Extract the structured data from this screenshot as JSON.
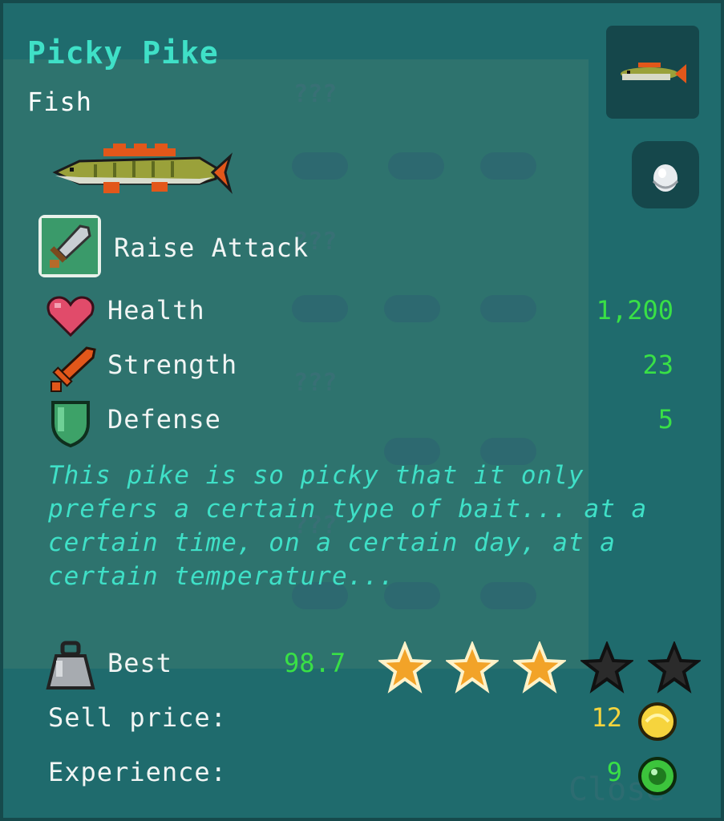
{
  "fish": {
    "name": "Picky Pike",
    "category": "Fish"
  },
  "ability": {
    "label": "Raise Attack",
    "icon": "sword-icon"
  },
  "stats": [
    {
      "label": "Health",
      "value": "1,200",
      "icon": "heart-icon"
    },
    {
      "label": "Strength",
      "value": "23",
      "icon": "sword-icon"
    },
    {
      "label": "Defense",
      "value": "5",
      "icon": "shield-icon"
    }
  ],
  "description": "This pike is so picky that it only prefers a certain type of bait... at a certain time, on a certain day, at a certain temperature...",
  "record": {
    "label": "Best",
    "value": "98.7",
    "stars_filled": 3,
    "stars_total": 5
  },
  "sell": {
    "label": "Sell price:",
    "value": "12"
  },
  "experience": {
    "label": "Experience:",
    "value": "9"
  },
  "background_labels": [
    "???",
    "???",
    "???",
    "???"
  ],
  "close_label": "Close",
  "colors": {
    "title": "#3fe0c7",
    "value_green": "#39e046",
    "gold": "#f6d43d",
    "panel": "#1f6b6d",
    "star_filled": "#f2a328",
    "star_empty": "#2b2b2b"
  }
}
